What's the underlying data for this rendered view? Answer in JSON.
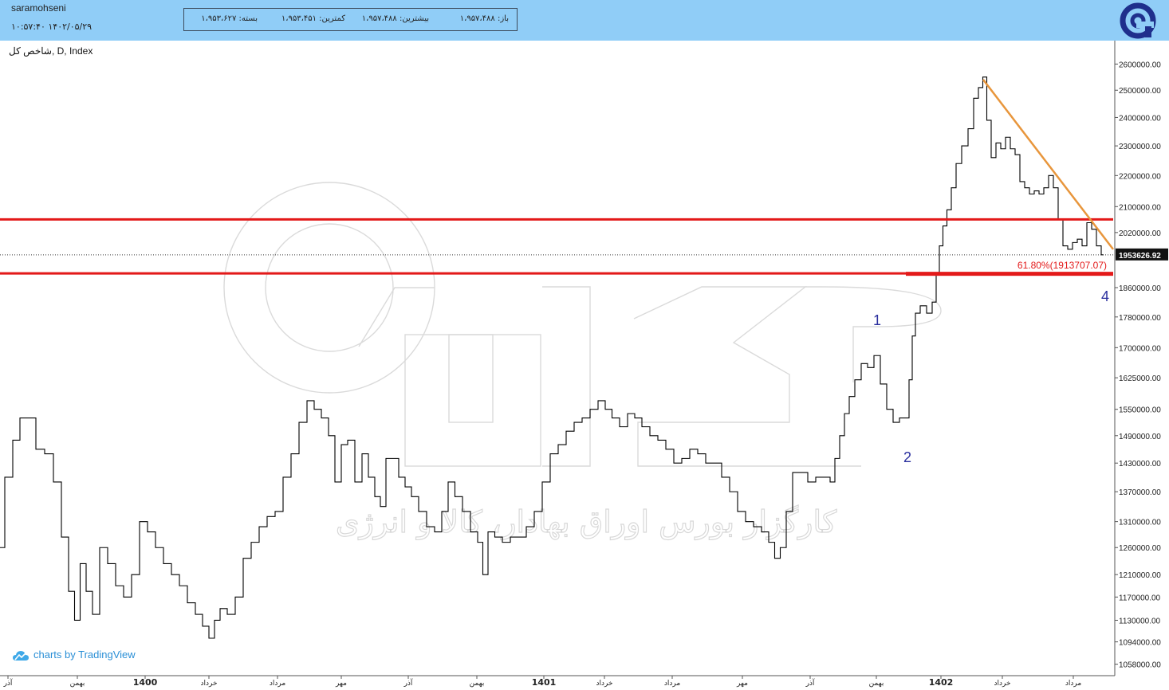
{
  "header": {
    "user": "saramohseni",
    "datetime": "۱۴۰۲/۰۵/۲۹ ۱۰:۵۷:۴۰",
    "ohlc": {
      "open": "باز: ۱،۹۵۷،۴۸۸",
      "high": "بیشترین: ۱،۹۵۷،۴۸۸",
      "low": "کمترین: ۱،۹۵۳،۴۵۱",
      "close": "بسته: ۱،۹۵۳،۶۲۷"
    },
    "logo_icon": "broker-logo-icon",
    "colors": {
      "header_bg": "#90cdf7",
      "logo": "#1f2f8c"
    }
  },
  "symbol_label": "شاخص کل, D, Index",
  "attribution": "charts by TradingView",
  "watermark": {
    "text": "کارگزار بورس اوراق بهادار، کالا و انرژی"
  },
  "chart_data": {
    "type": "line",
    "x_tick_labels": [
      "آذر",
      "بهمن",
      "1400",
      "خرداد",
      "مرداد",
      "مهر",
      "آذر",
      "بهمن",
      "1401",
      "خرداد",
      "مرداد",
      "مهر",
      "آذر",
      "بهمن",
      "1402",
      "خرداد",
      "مرداد"
    ],
    "y_tick_labels": [
      "2600000.00",
      "2500000.00",
      "2400000.00",
      "2300000.00",
      "2200000.00",
      "2100000.00",
      "2020000.00",
      "1860000.00",
      "1780000.00",
      "1700000.00",
      "1625000.00",
      "1550000.00",
      "1490000.00",
      "1430000.00",
      "1370000.00",
      "1310000.00",
      "1260000.00",
      "1210000.00",
      "1170000.00",
      "1130000.00",
      "1094000.00",
      "1058000.00"
    ],
    "y_scale": "log",
    "ylim": [
      1040000,
      2680000
    ],
    "series": [
      {
        "points": [
          [
            0,
            1260000
          ],
          [
            12,
            1400000
          ],
          [
            20,
            1480000
          ],
          [
            30,
            1530000
          ],
          [
            40,
            1530000
          ],
          [
            50,
            1460000
          ],
          [
            62,
            1450000
          ],
          [
            72,
            1390000
          ],
          [
            82,
            1280000
          ],
          [
            90,
            1180000
          ],
          [
            97,
            1130000
          ],
          [
            104,
            1230000
          ],
          [
            112,
            1180000
          ],
          [
            120,
            1140000
          ],
          [
            130,
            1260000
          ],
          [
            140,
            1230000
          ],
          [
            150,
            1190000
          ],
          [
            160,
            1170000
          ],
          [
            170,
            1210000
          ],
          [
            180,
            1310000
          ],
          [
            190,
            1290000
          ],
          [
            200,
            1260000
          ],
          [
            210,
            1230000
          ],
          [
            220,
            1210000
          ],
          [
            230,
            1190000
          ],
          [
            240,
            1160000
          ],
          [
            250,
            1140000
          ],
          [
            258,
            1120000
          ],
          [
            266,
            1100000
          ],
          [
            272,
            1130000
          ],
          [
            280,
            1150000
          ],
          [
            290,
            1140000
          ],
          [
            300,
            1170000
          ],
          [
            310,
            1240000
          ],
          [
            320,
            1270000
          ],
          [
            330,
            1300000
          ],
          [
            340,
            1320000
          ],
          [
            350,
            1330000
          ],
          [
            360,
            1400000
          ],
          [
            370,
            1450000
          ],
          [
            380,
            1520000
          ],
          [
            390,
            1570000
          ],
          [
            398,
            1550000
          ],
          [
            408,
            1530000
          ],
          [
            416,
            1490000
          ],
          [
            424,
            1390000
          ],
          [
            432,
            1470000
          ],
          [
            440,
            1480000
          ],
          [
            450,
            1390000
          ],
          [
            458,
            1450000
          ],
          [
            466,
            1400000
          ],
          [
            474,
            1360000
          ],
          [
            480,
            1340000
          ],
          [
            488,
            1440000
          ],
          [
            496,
            1440000
          ],
          [
            504,
            1400000
          ],
          [
            512,
            1380000
          ],
          [
            520,
            1360000
          ],
          [
            530,
            1330000
          ],
          [
            540,
            1300000
          ],
          [
            550,
            1290000
          ],
          [
            558,
            1330000
          ],
          [
            566,
            1390000
          ],
          [
            575,
            1360000
          ],
          [
            585,
            1330000
          ],
          [
            595,
            1290000
          ],
          [
            603,
            1270000
          ],
          [
            608,
            1210000
          ],
          [
            616,
            1290000
          ],
          [
            625,
            1280000
          ],
          [
            635,
            1270000
          ],
          [
            645,
            1280000
          ],
          [
            655,
            1280000
          ],
          [
            665,
            1300000
          ],
          [
            675,
            1330000
          ],
          [
            685,
            1390000
          ],
          [
            695,
            1450000
          ],
          [
            705,
            1470000
          ],
          [
            715,
            1500000
          ],
          [
            725,
            1520000
          ],
          [
            735,
            1530000
          ],
          [
            745,
            1550000
          ],
          [
            755,
            1570000
          ],
          [
            763,
            1550000
          ],
          [
            772,
            1530000
          ],
          [
            782,
            1510000
          ],
          [
            792,
            1540000
          ],
          [
            800,
            1530000
          ],
          [
            810,
            1510000
          ],
          [
            820,
            1490000
          ],
          [
            830,
            1480000
          ],
          [
            840,
            1460000
          ],
          [
            850,
            1430000
          ],
          [
            860,
            1440000
          ],
          [
            870,
            1460000
          ],
          [
            880,
            1450000
          ],
          [
            890,
            1430000
          ],
          [
            900,
            1430000
          ],
          [
            910,
            1400000
          ],
          [
            920,
            1370000
          ],
          [
            930,
            1330000
          ],
          [
            940,
            1310000
          ],
          [
            950,
            1300000
          ],
          [
            960,
            1290000
          ],
          [
            968,
            1270000
          ],
          [
            975,
            1240000
          ],
          [
            982,
            1260000
          ],
          [
            990,
            1330000
          ],
          [
            998,
            1410000
          ],
          [
            1008,
            1410000
          ],
          [
            1018,
            1390000
          ],
          [
            1028,
            1400000
          ],
          [
            1038,
            1400000
          ],
          [
            1044,
            1390000
          ],
          [
            1050,
            1440000
          ],
          [
            1056,
            1490000
          ],
          [
            1062,
            1540000
          ],
          [
            1068,
            1580000
          ],
          [
            1076,
            1620000
          ],
          [
            1084,
            1660000
          ],
          [
            1092,
            1650000
          ],
          [
            1100,
            1680000
          ],
          [
            1108,
            1610000
          ],
          [
            1116,
            1550000
          ],
          [
            1124,
            1520000
          ],
          [
            1132,
            1530000
          ],
          [
            1138,
            1530000
          ],
          [
            1142,
            1620000
          ],
          [
            1146,
            1730000
          ],
          [
            1150,
            1790000
          ],
          [
            1158,
            1810000
          ],
          [
            1166,
            1790000
          ],
          [
            1172,
            1820000
          ],
          [
            1176,
            1900000
          ],
          [
            1180,
            1980000
          ],
          [
            1185,
            2040000
          ],
          [
            1190,
            2090000
          ],
          [
            1196,
            2160000
          ],
          [
            1202,
            2240000
          ],
          [
            1210,
            2300000
          ],
          [
            1218,
            2360000
          ],
          [
            1224,
            2470000
          ],
          [
            1230,
            2510000
          ],
          [
            1235,
            2550000
          ],
          [
            1240,
            2390000
          ],
          [
            1246,
            2260000
          ],
          [
            1252,
            2310000
          ],
          [
            1258,
            2290000
          ],
          [
            1264,
            2330000
          ],
          [
            1270,
            2290000
          ],
          [
            1276,
            2270000
          ],
          [
            1282,
            2180000
          ],
          [
            1288,
            2160000
          ],
          [
            1294,
            2140000
          ],
          [
            1300,
            2150000
          ],
          [
            1306,
            2140000
          ],
          [
            1312,
            2160000
          ],
          [
            1318,
            2200000
          ],
          [
            1324,
            2160000
          ],
          [
            1330,
            2060000
          ],
          [
            1336,
            1980000
          ],
          [
            1342,
            1970000
          ],
          [
            1348,
            1990000
          ],
          [
            1354,
            2000000
          ],
          [
            1360,
            1980000
          ],
          [
            1366,
            2050000
          ],
          [
            1372,
            2030000
          ],
          [
            1378,
            1980000
          ],
          [
            1384,
            1953627
          ]
        ]
      }
    ],
    "overlays": {
      "horizontal_lines": [
        2060000,
        1900000
      ],
      "trendline": [
        [
          1233,
          2540000
        ],
        [
          1396,
          1970000
        ]
      ],
      "fib_label": "61.80%(1913707.07)",
      "last_price_label": "1953626.92",
      "wave_labels": [
        "1",
        "2",
        "4"
      ]
    },
    "colors": {
      "price_line": "#000000",
      "support_resistance": "#e31919",
      "trendline": "#e8963c",
      "fib_text": "#e31919",
      "wave_label": "#2a2f9e",
      "last_price_bg": "#111111"
    },
    "grid": false
  }
}
